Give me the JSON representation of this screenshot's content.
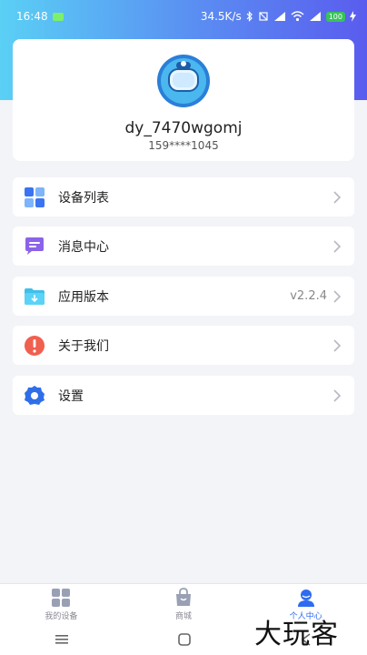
{
  "status_bar": {
    "time": "16:48",
    "net_speed": "34.5K/s",
    "battery": "100"
  },
  "profile": {
    "username": "dy_7470wgomj",
    "phone": "159****1045"
  },
  "menu": [
    {
      "label": "设备列表",
      "icon": "grid-icon",
      "value": ""
    },
    {
      "label": "消息中心",
      "icon": "message-icon",
      "value": ""
    },
    {
      "label": "应用版本",
      "icon": "folder-icon",
      "value": "v2.2.4"
    },
    {
      "label": "关于我们",
      "icon": "info-icon",
      "value": ""
    },
    {
      "label": "设置",
      "icon": "gear-icon",
      "value": ""
    }
  ],
  "bottom_nav": [
    {
      "label": "我的设备",
      "icon": "devices-icon"
    },
    {
      "label": "商城",
      "icon": "shop-bag-icon"
    },
    {
      "label": "个人中心",
      "icon": "person-icon",
      "active": true
    }
  ],
  "watermark": "大玩客",
  "colors": {
    "accent": "#2e6bf0",
    "gradient_start": "#5ad0f5",
    "gradient_end": "#5a5cee"
  }
}
